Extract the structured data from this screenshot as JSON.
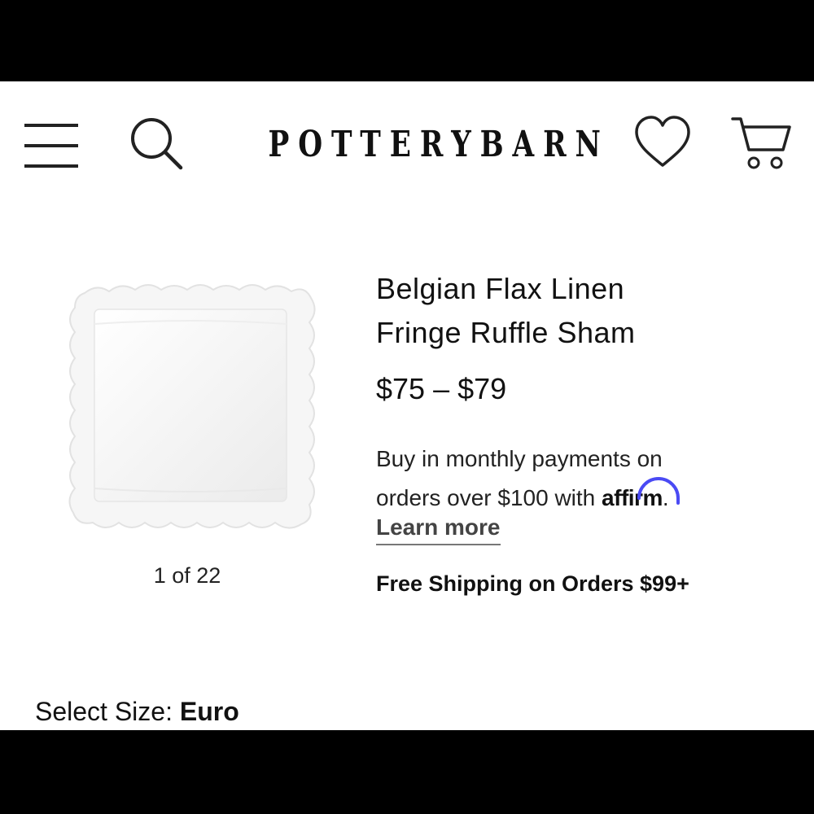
{
  "header": {
    "brand": "POTTERYBARN",
    "icons": {
      "menu": "hamburger-menu-icon",
      "search": "search-icon",
      "wishlist": "heart-icon",
      "cart": "cart-icon"
    }
  },
  "product": {
    "title_line1": "Belgian Flax Linen",
    "title_line2": "Fringe Ruffle Sham",
    "price": "$75 – $79",
    "image_counter": "1 of 22",
    "payments_line1": "Buy in monthly payments on",
    "payments_line2_prefix": "orders over $100 with ",
    "affirm": "affirm",
    "payments_line2_suffix": ".",
    "learn_more": "Learn more",
    "free_shipping": "Free Shipping on Orders $99+",
    "select_size_label": "Select Size: ",
    "select_size_value": "Euro"
  },
  "colors": {
    "affirm_arc": "#4a4af4",
    "text": "#111111"
  }
}
